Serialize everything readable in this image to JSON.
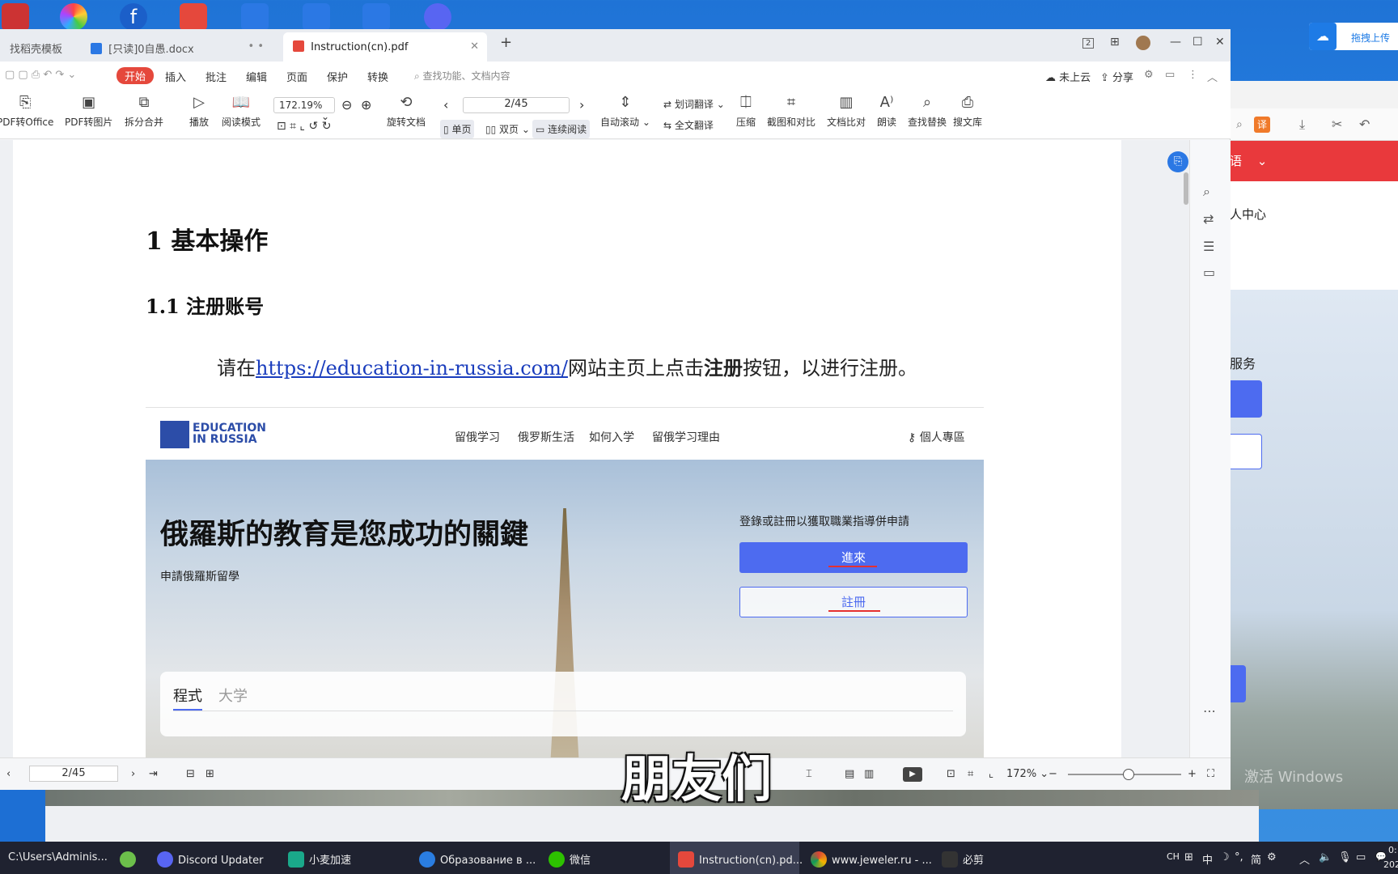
{
  "desktop": {
    "cloud_button_label": "拖拽上传"
  },
  "tabs": [
    {
      "label": "找稻壳模板"
    },
    {
      "label": "[只读]0自愚.docx"
    },
    {
      "label": "Instruction(cn).pdf"
    }
  ],
  "window_controls": {
    "tab_count": "2"
  },
  "menu": {
    "start": "开始",
    "items": [
      "插入",
      "批注",
      "编辑",
      "页面",
      "保护",
      "转换"
    ],
    "search_placeholder": "查找功能、文档内容",
    "cloud_status": "未上云",
    "share": "分享"
  },
  "toolbar": {
    "pdf_to_office": "PDF转Office",
    "pdf_to_image": "PDF转图片",
    "split_merge": "拆分合并",
    "play": "播放",
    "read_mode": "阅读模式",
    "zoom": "172.19%",
    "page": "2/45",
    "rotate": "旋转文档",
    "single": "单页",
    "double": "双页",
    "continuous": "连续阅读",
    "auto_scroll": "自动滚动",
    "word_translate": "划词翻译",
    "full_translate": "全文翻译",
    "compress": "压缩",
    "screenshot_compare": "截图和对比",
    "doc_compare": "文档比对",
    "read_aloud": "朗读",
    "find_replace": "查找替换",
    "search_lib": "搜文库"
  },
  "document": {
    "heading1": "1 基本操作",
    "heading2": "1.1 注册账号",
    "para_before": "请在",
    "link": "https://education-in-russia.com/",
    "para_mid": "网站主页上点击",
    "para_bold": "注册",
    "para_after": "按钮，以进行注册。"
  },
  "website": {
    "logo_line1": "EDUCATION",
    "logo_line2": "IN RUSSIA",
    "nav": [
      "留俄学习",
      "俄罗斯生活",
      "如何入学",
      "留俄学习理由"
    ],
    "account": "個人專區",
    "hero_title": "俄羅斯的教育是您成功的關鍵",
    "hero_sub": "申請俄羅斯留學",
    "login_hint": "登錄或註冊以獲取職業指導併申請",
    "enter": "進來",
    "register": "註冊",
    "tab_program": "程式",
    "tab_university": "大学"
  },
  "status_bar": {
    "page": "2/45",
    "zoom": "172%"
  },
  "subtitle": "朋友们",
  "background_window": {
    "menu_fragment": "语",
    "center": "人中心",
    "service": "服务",
    "watermark": "激活 Windows"
  },
  "taskbar": {
    "items": [
      {
        "label": "C:\\Users\\Adminis..."
      },
      {
        "label": "Discord Updater"
      },
      {
        "label": "小麦加速"
      },
      {
        "label": "Образование в ..."
      },
      {
        "label": "微信"
      },
      {
        "label": "Instruction(cn).pd..."
      },
      {
        "label": "www.jeweler.ru - ..."
      },
      {
        "label": "必剪"
      }
    ],
    "ime": "中",
    "ime2": "简",
    "lang": "CH",
    "time": "0:",
    "date": "202"
  },
  "colors": {
    "accent_red": "#e5483c",
    "website_blue": "#4d6bf0",
    "link_blue": "#1a3dbd"
  }
}
